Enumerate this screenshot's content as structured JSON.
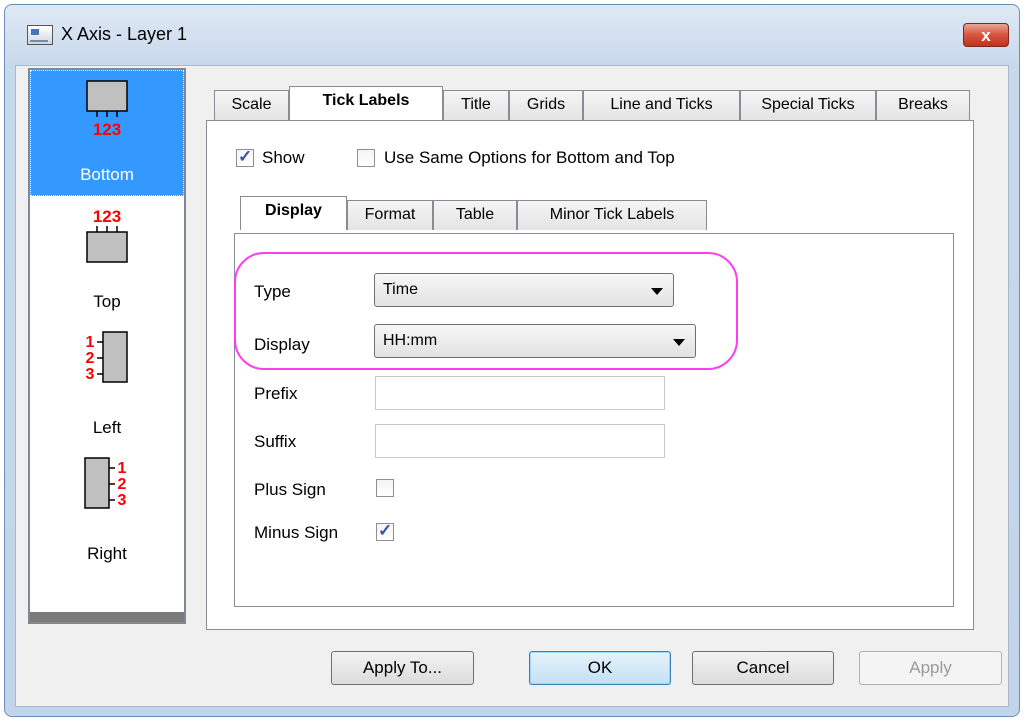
{
  "window": {
    "title": "X Axis - Layer 1",
    "close_glyph": "x"
  },
  "sidebar": {
    "items": [
      {
        "label": "Bottom",
        "icon": "axis-bottom-icon",
        "ticks": "123"
      },
      {
        "label": "Top",
        "icon": "axis-top-icon",
        "ticks": "123"
      },
      {
        "label": "Left",
        "icon": "axis-left-icon",
        "ticks": "123"
      },
      {
        "label": "Right",
        "icon": "axis-right-icon",
        "ticks": "123"
      }
    ],
    "selected": "Bottom"
  },
  "tabs": [
    "Scale",
    "Tick Labels",
    "Title",
    "Grids",
    "Line and Ticks",
    "Special Ticks",
    "Breaks"
  ],
  "active_tab": "Tick Labels",
  "show": {
    "label": "Show",
    "checked": true
  },
  "same_options": {
    "label": "Use Same Options for Bottom and Top",
    "checked": false
  },
  "subtabs": [
    "Display",
    "Format",
    "Table",
    "Minor Tick Labels"
  ],
  "active_subtab": "Display",
  "form": {
    "type_label": "Type",
    "type_value": "Time",
    "display_label": "Display",
    "display_value": "HH:mm",
    "prefix_label": "Prefix",
    "prefix_value": "",
    "suffix_label": "Suffix",
    "suffix_value": "",
    "plus_sign_label": "Plus Sign",
    "plus_sign_checked": false,
    "minus_sign_label": "Minus Sign",
    "minus_sign_checked": true
  },
  "buttons": {
    "apply_to": "Apply To...",
    "ok": "OK",
    "cancel": "Cancel",
    "apply": "Apply"
  },
  "colors": {
    "highlight": "#ff3cf2",
    "selection": "#3399ff",
    "tick_labels": "#ff0000"
  }
}
